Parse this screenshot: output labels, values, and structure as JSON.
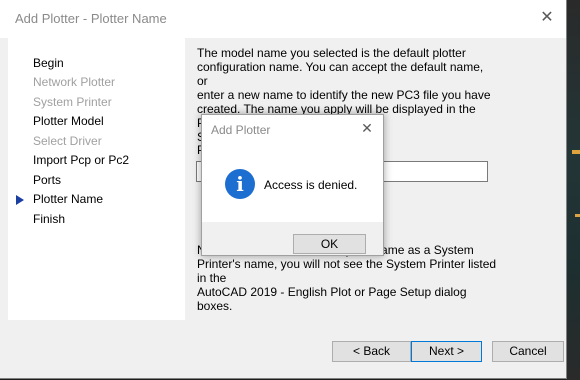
{
  "window": {
    "title": "Add Plotter - Plotter Name",
    "close_glyph": "✕"
  },
  "steps": [
    {
      "label": "Begin",
      "enabled": true
    },
    {
      "label": "Network Plotter",
      "enabled": false
    },
    {
      "label": "System Printer",
      "enabled": false
    },
    {
      "label": "Plotter Model",
      "enabled": true
    },
    {
      "label": "Select Driver",
      "enabled": false
    },
    {
      "label": "Import Pcp or Pc2",
      "enabled": true
    },
    {
      "label": "Ports",
      "enabled": true
    },
    {
      "label": "Plotter Name",
      "enabled": true,
      "current": true
    },
    {
      "label": "Finish",
      "enabled": true
    }
  ],
  "main": {
    "description_lines": [
      "The model name you selected is the default plotter",
      "configuration name. You can accept the default name, or",
      "enter a new name to identify the new PC3 file you have",
      "created. The name you apply will be displayed in the Page",
      "Setup and Plot dialog boxes."
    ],
    "field_label_visible": "P",
    "name_input_visible_value": "I",
    "note_lines_visible": [
      "N                                          y the same as a System",
      "Printer's name, you will not see the System Printer listed in the",
      "AutoCAD 2019 - English Plot or Page Setup dialog boxes."
    ]
  },
  "buttons": {
    "back": "< Back",
    "next": "Next >",
    "cancel": "Cancel"
  },
  "modal": {
    "title": "Add Plotter",
    "close_glyph": "✕",
    "icon": "info-icon",
    "icon_glyph": "i",
    "message": "Access is denied.",
    "ok": "OK"
  },
  "colors": {
    "accent": "#0078d7",
    "info_icon": "#1c6fd1",
    "current_step_arrow": "#1a3fa0"
  }
}
